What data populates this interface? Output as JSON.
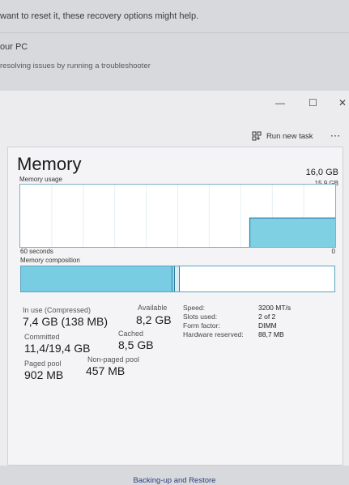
{
  "background": {
    "line1": "want to reset it, these recovery options might help.",
    "line2": "our PC",
    "line3": "resolving issues by running a troubleshooter"
  },
  "window": {
    "minimize": "—",
    "maximize": "☐",
    "close": "✕"
  },
  "command_bar": {
    "run_new_task": "Run new task",
    "more": "···"
  },
  "memory": {
    "title": "Memory",
    "total": "16,0 GB",
    "usage_label": "Memory usage",
    "usage_max": "15,9 GB",
    "time_label": "60 seconds",
    "time_min": "0",
    "composition_label": "Memory composition",
    "usage_history_gb": [
      null,
      null,
      null,
      null,
      null,
      null,
      null,
      null,
      null,
      null,
      null,
      null,
      null,
      null,
      null,
      null,
      null,
      null,
      null,
      null,
      null,
      null,
      null,
      null,
      null,
      null,
      null,
      null,
      null,
      null,
      null,
      null,
      null,
      null,
      null,
      null,
      null,
      null,
      null,
      null,
      null,
      null,
      null,
      7.4,
      7.4,
      7.4,
      7.4,
      7.4,
      7.4,
      7.4,
      7.4,
      7.4,
      7.4,
      7.4,
      7.4,
      7.4,
      7.4,
      7.4,
      7.4,
      7.4
    ]
  },
  "stats": {
    "in_use_label": "In use (Compressed)",
    "in_use_value": "7,4 GB (138 MB)",
    "available_label": "Available",
    "available_value": "8,2 GB",
    "committed_label": "Committed",
    "committed_value": "11,4/19,4 GB",
    "cached_label": "Cached",
    "cached_value": "8,5 GB",
    "paged_pool_label": "Paged pool",
    "paged_pool_value": "902 MB",
    "non_paged_pool_label": "Non-paged pool",
    "non_paged_pool_value": "457 MB"
  },
  "specs": {
    "speed_label": "Speed:",
    "speed_value": "3200 MT/s",
    "slots_label": "Slots used:",
    "slots_value": "2 of 2",
    "form_label": "Form factor:",
    "form_value": "DIMM",
    "reserved_label": "Hardware reserved:",
    "reserved_value": "88,7 MB"
  },
  "footer": {
    "text": "Backing-up and Restore"
  },
  "colors": {
    "graph_fill": "#7fd0e3",
    "graph_line": "#2a7ca8",
    "accent": "#5aa3c3"
  }
}
